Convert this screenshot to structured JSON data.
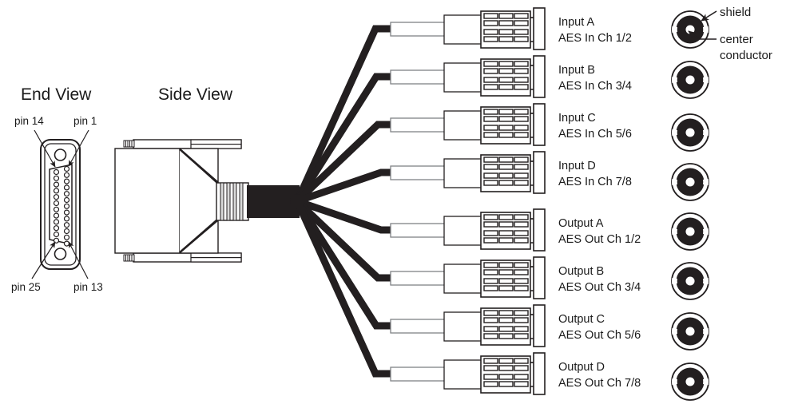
{
  "diagram": {
    "title_end_view": "End View",
    "title_side_view": "Side View",
    "colors": {
      "line": "#231f20",
      "cable": "#231f20",
      "text": "#1a1a1a",
      "fill": "#ffffff",
      "body_outline": "#58595b",
      "background": "#ffffff"
    }
  },
  "end_view": {
    "title": "End View",
    "pin_labels": {
      "top_left": "pin 14",
      "top_right": "pin 1",
      "bottom_left": "pin 25",
      "bottom_right": "pin 13"
    },
    "pin_count_total": 25,
    "pin_column_right_count": 13,
    "pin_column_left_count": 12,
    "connector_type": "DB25"
  },
  "side_view": {
    "title": "Side View"
  },
  "branches": [
    {
      "id": "input-a",
      "name": "Input A",
      "channels": "AES In Ch 1/2"
    },
    {
      "id": "input-b",
      "name": "Input B",
      "channels": "AES In Ch 3/4"
    },
    {
      "id": "input-c",
      "name": "Input C",
      "channels": "AES In Ch 5/6"
    },
    {
      "id": "input-d",
      "name": "Input D",
      "channels": "AES In Ch 7/8"
    },
    {
      "id": "output-a",
      "name": "Output A",
      "channels": "AES Out Ch 1/2"
    },
    {
      "id": "output-b",
      "name": "Output B",
      "channels": "AES Out Ch 3/4"
    },
    {
      "id": "output-c",
      "name": "Output C",
      "channels": "AES Out Ch 5/6"
    },
    {
      "id": "output-d",
      "name": "Output D",
      "channels": "AES Out Ch 7/8"
    }
  ],
  "annotations": {
    "shield": "shield",
    "center_conductor_line1": "center",
    "center_conductor_line2": "conductor"
  },
  "bnc_faces": {
    "count": 8,
    "parts": [
      "shield",
      "center conductor"
    ]
  }
}
